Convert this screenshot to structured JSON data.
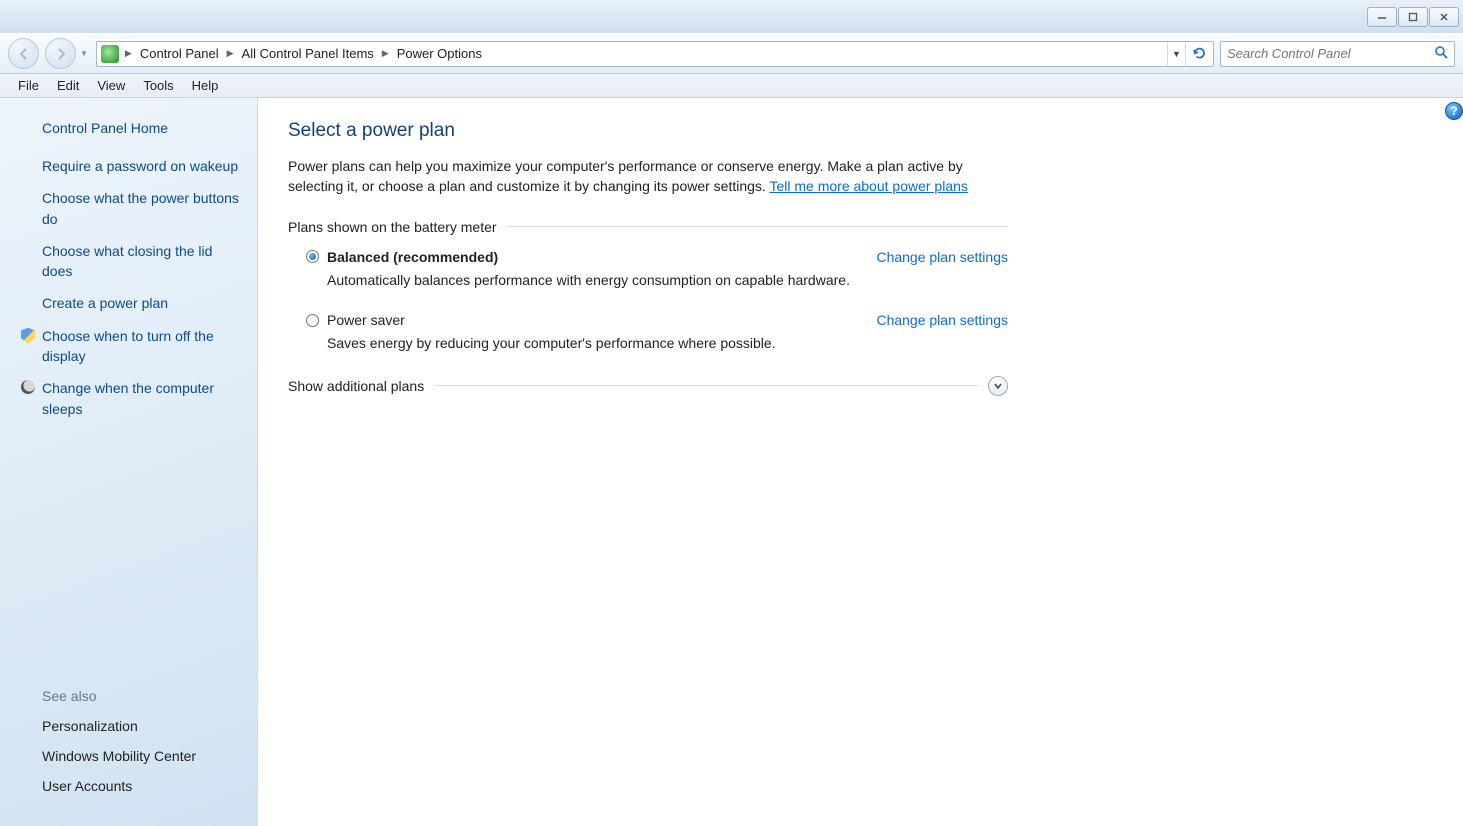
{
  "breadcrumbs": [
    "Control Panel",
    "All Control Panel Items",
    "Power Options"
  ],
  "search": {
    "placeholder": "Search Control Panel"
  },
  "menubar": [
    "File",
    "Edit",
    "View",
    "Tools",
    "Help"
  ],
  "sidebar": {
    "home": "Control Panel Home",
    "links": [
      {
        "label": "Require a password on wakeup",
        "icon": ""
      },
      {
        "label": "Choose what the power buttons do",
        "icon": ""
      },
      {
        "label": "Choose what closing the lid does",
        "icon": ""
      },
      {
        "label": "Create a power plan",
        "icon": ""
      },
      {
        "label": "Choose when to turn off the display",
        "icon": "shield"
      },
      {
        "label": "Change when the computer sleeps",
        "icon": "moon"
      }
    ],
    "seealso_heading": "See also",
    "seealso": [
      "Personalization",
      "Windows Mobility Center",
      "User Accounts"
    ]
  },
  "main": {
    "heading": "Select a power plan",
    "intro_pre": "Power plans can help you maximize your computer's performance or conserve energy. Make a plan active by selecting it, or choose a plan and customize it by changing its power settings. ",
    "intro_link": "Tell me more about power plans",
    "section_battery": "Plans shown on the battery meter",
    "plans": [
      {
        "name": "Balanced (recommended)",
        "selected": true,
        "desc": "Automatically balances performance with energy consumption on capable hardware.",
        "change": "Change plan settings"
      },
      {
        "name": "Power saver",
        "selected": false,
        "desc": "Saves energy by reducing your computer's performance where possible.",
        "change": "Change plan settings"
      }
    ],
    "expander_label": "Show additional plans"
  }
}
